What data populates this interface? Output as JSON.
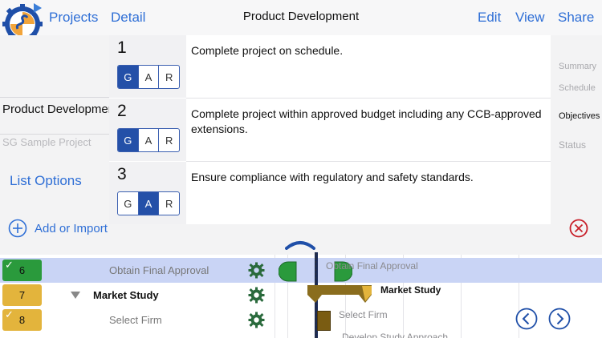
{
  "nav": {
    "projects_label": "Projects",
    "detail_label": "Detail",
    "title": "Product Development",
    "edit_label": "Edit",
    "view_label": "View",
    "share_label": "Share"
  },
  "left_panel": {
    "project_name": "Product Development",
    "project_sub": "SG Sample Project",
    "list_options_label": "List Options"
  },
  "right_tabs": {
    "summary": "Summary",
    "schedule": "Schedule",
    "objectives": "Objectives",
    "status": "Status"
  },
  "objectives": [
    {
      "number": "1",
      "text": "Complete project on schedule.",
      "gar": [
        "G",
        "A",
        "R"
      ],
      "selected": "G"
    },
    {
      "number": "2",
      "text": "Complete project within approved budget including any CCB-approved extensions.",
      "gar": [
        "G",
        "A",
        "R"
      ],
      "selected": "G"
    },
    {
      "number": "3",
      "text": "Ensure compliance with regulatory and safety standards.",
      "gar": [
        "G",
        "A",
        "R"
      ],
      "selected": "A"
    }
  ],
  "actions": {
    "add_label": "Add or Import"
  },
  "schedule_rows": [
    {
      "num": "6",
      "label": "Obtain Final Approval",
      "checked": true
    },
    {
      "num": "7",
      "label": "Market Study",
      "checked": false
    },
    {
      "num": "8",
      "label": "Select Firm",
      "checked": true
    }
  ],
  "gantt": {
    "obtain_final_approval": "Obtain Final Approval",
    "market_study": "Market Study",
    "select_firm": "Select Firm",
    "develop_study_approach": "Develop Study Approach"
  },
  "colors": {
    "accent_blue": "#2f6fd6",
    "gar_selected": "#2450a8",
    "done_green": "#2a9a3c",
    "task_gold": "#e3b43c",
    "summary_bar": "#8a6d1e",
    "close_red": "#c8202a"
  }
}
